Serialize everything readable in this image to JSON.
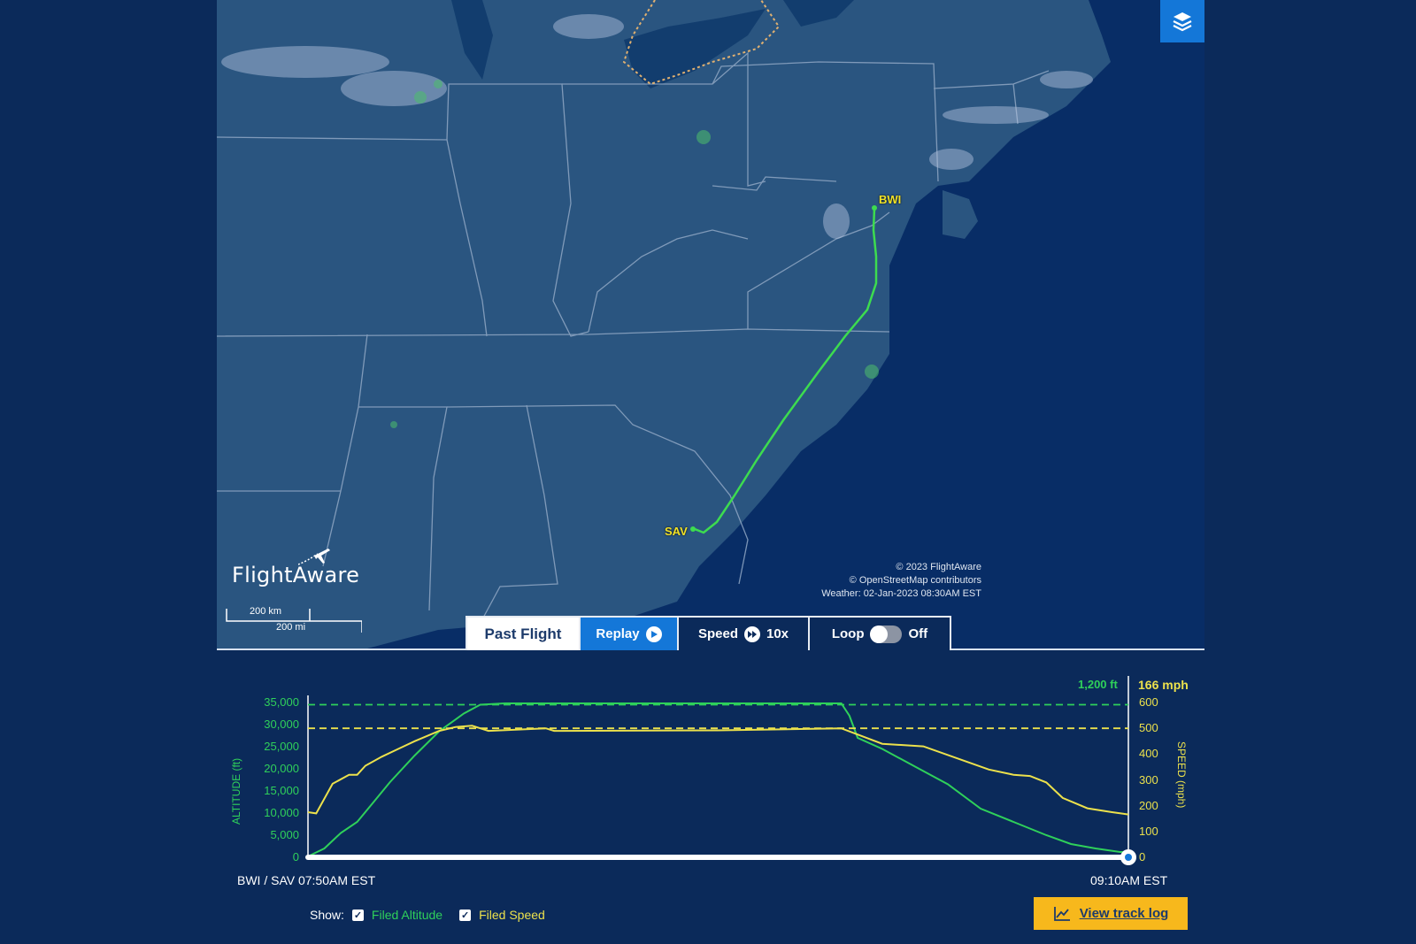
{
  "map": {
    "origin_code": "BWI",
    "destination_code": "SAV",
    "logo_text": "FlightAware",
    "scale_km": "200 km",
    "scale_mi": "200 mi",
    "copyright_line1": "© 2023 FlightAware",
    "copyright_line2": "© OpenStreetMap contributors",
    "weather_line": "Weather: 02-Jan-2023 08:30AM EST",
    "layers_icon": "layers-icon"
  },
  "controls": {
    "past_flight": "Past Flight",
    "replay": "Replay",
    "speed": "Speed",
    "speed_value": "10x",
    "loop": "Loop",
    "loop_state": "Off"
  },
  "chart": {
    "altitude_readout": "1,200 ft",
    "speed_readout": "166 mph",
    "left_axis_title": "ALTITUDE (ft)",
    "right_axis_title": "SPEED (mph)",
    "left_ticks": [
      "35,000",
      "30,000",
      "25,000",
      "20,000",
      "15,000",
      "10,000",
      "5,000",
      "0"
    ],
    "right_ticks": [
      "600",
      "500",
      "400",
      "300",
      "200",
      "100",
      "0"
    ],
    "start_label": "BWI / SAV 07:50AM EST",
    "end_label": "09:10AM EST",
    "show_label": "Show:",
    "filed_altitude": "Filed Altitude",
    "filed_speed": "Filed Speed",
    "track_log": "View track log",
    "colors": {
      "altitude": "#2fd05a",
      "speed": "#ece14c"
    }
  },
  "chart_data": {
    "type": "line",
    "x_range": [
      "07:50AM EST",
      "09:10AM EST"
    ],
    "progress": 1.0,
    "series": [
      {
        "name": "ALTITUDE (ft)",
        "axis": "left",
        "ylim": [
          0,
          35000
        ],
        "x": [
          0,
          0.02,
          0.04,
          0.06,
          0.08,
          0.1,
          0.13,
          0.16,
          0.19,
          0.21,
          0.24,
          0.27,
          0.3,
          0.5,
          0.6,
          0.65,
          0.66,
          0.67,
          0.7,
          0.74,
          0.78,
          0.82,
          0.86,
          0.9,
          0.93,
          0.96,
          0.99,
          1.0
        ],
        "values": [
          200,
          2000,
          5500,
          8000,
          12500,
          17000,
          23000,
          28500,
          32500,
          34500,
          34800,
          34800,
          34800,
          34800,
          34800,
          34800,
          32000,
          27000,
          24500,
          20500,
          16500,
          11000,
          8000,
          5000,
          3000,
          2000,
          1200,
          1200
        ]
      },
      {
        "name": "SPEED (mph)",
        "axis": "right",
        "ylim": [
          0,
          600
        ],
        "x": [
          0,
          0.01,
          0.03,
          0.05,
          0.06,
          0.07,
          0.09,
          0.11,
          0.13,
          0.16,
          0.18,
          0.2,
          0.21,
          0.22,
          0.29,
          0.3,
          0.5,
          0.65,
          0.7,
          0.75,
          0.79,
          0.83,
          0.86,
          0.88,
          0.9,
          0.92,
          0.95,
          0.98,
          1.0
        ],
        "values": [
          175,
          170,
          285,
          320,
          320,
          355,
          390,
          420,
          450,
          490,
          505,
          510,
          500,
          490,
          500,
          490,
          492,
          500,
          440,
          430,
          385,
          340,
          320,
          315,
          290,
          230,
          190,
          175,
          166
        ]
      },
      {
        "name": "Filed Altitude",
        "axis": "left",
        "dashed": true,
        "x": [
          0,
          1
        ],
        "values": [
          34500,
          34500
        ]
      },
      {
        "name": "Filed Speed",
        "axis": "right",
        "dashed": true,
        "x": [
          0,
          1
        ],
        "values": [
          500,
          500
        ]
      }
    ]
  }
}
